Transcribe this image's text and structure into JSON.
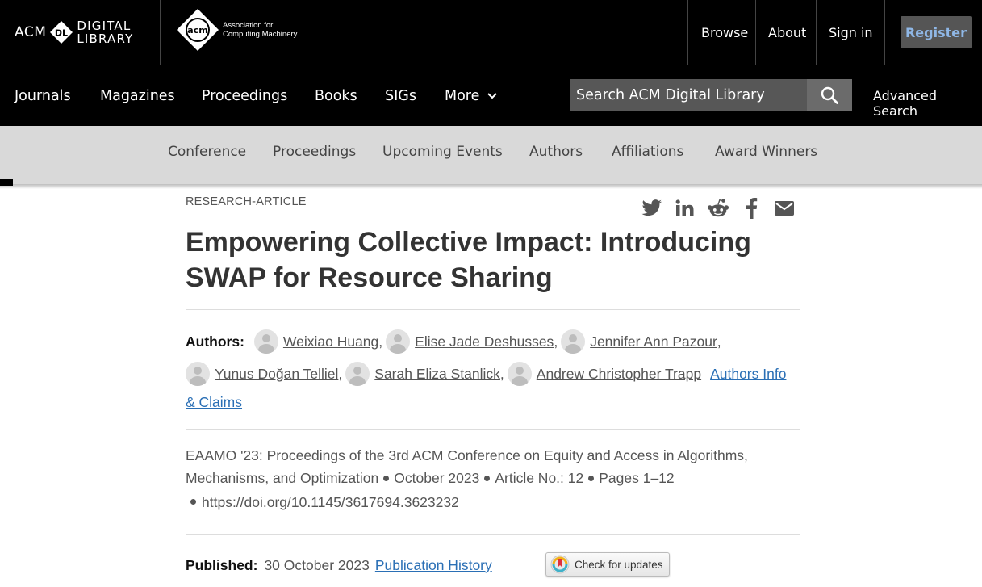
{
  "header": {
    "dl_logo_acm": "ACM",
    "dl_logo_badge": "DL",
    "dl_logo_line1": "DIGITAL",
    "dl_logo_line2": "LIBRARY",
    "acm_badge": "acm",
    "acm_org_line1": "Association for",
    "acm_org_line2": "Computing Machinery",
    "nav": [
      "Browse",
      "About",
      "Sign in"
    ],
    "register_label": "Register"
  },
  "main_nav": {
    "items": [
      "Journals",
      "Magazines",
      "Proceedings",
      "Books",
      "SIGs",
      "More"
    ],
    "search_placeholder": "Search ACM Digital Library",
    "advanced_search": "Advanced Search"
  },
  "sub_nav": {
    "items": [
      "Conference",
      "Proceedings",
      "Upcoming Events",
      "Authors",
      "Affiliations",
      "Award Winners"
    ]
  },
  "article": {
    "type": "RESEARCH-ARTICLE",
    "title_line1": "Empowering Collective Impact: Introducing",
    "title_line2": "SWAP for Resource Sharing",
    "share_icons": [
      "twitter-icon",
      "linkedin-icon",
      "reddit-icon",
      "facebook-icon",
      "email-icon"
    ],
    "authors_label": "Authors:",
    "authors": [
      "Weixiao Huang",
      "Elise Jade Deshusses",
      "Jennifer Ann Pazour",
      "Yunus Doğan Telliel",
      "Sarah Eliza Stanlick",
      "Andrew Christopher Trapp"
    ],
    "author_sep": ",",
    "authors_info_part1": "Authors Info",
    "authors_info_part2": "& Claims",
    "proceedings_line1": "EAAMO '23: Proceedings of the 3rd ACM Conference on Equity and Access in Algorithms,",
    "proceedings_line2": "Mechanisms, and Optimization",
    "date": "October 2023",
    "article_no": "Article No.: 12",
    "pages": "Pages 1–12",
    "doi": "https://doi.org/10.1145/3617694.3623232",
    "published_label": "Published:",
    "published_date": "30 October 2023",
    "publication_history": "Publication History",
    "check_updates": "Check for updates"
  }
}
